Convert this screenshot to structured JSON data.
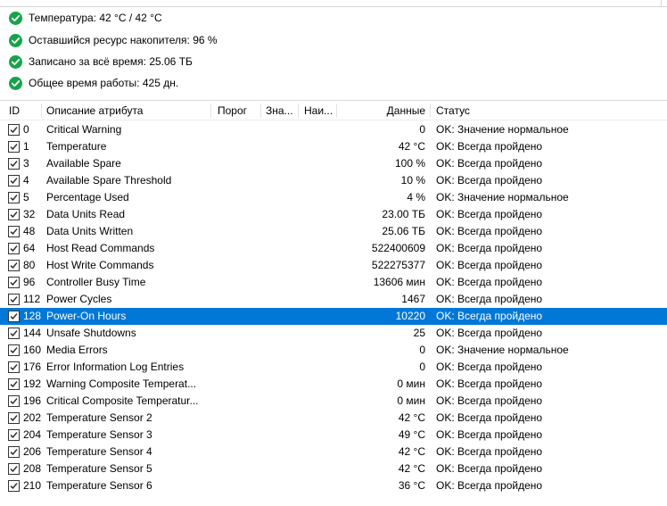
{
  "summary": [
    {
      "icon": "check-circle-icon",
      "text": "Температура: 42 °C / 42 °C"
    },
    {
      "icon": "check-circle-icon",
      "text": "Оставшийся ресурс накопителя: 96 %"
    },
    {
      "icon": "check-circle-icon",
      "text": "Записано за всё время: 25.06 ТБ"
    },
    {
      "icon": "check-circle-icon",
      "text": "Общее время работы: 425 дн."
    }
  ],
  "columns": {
    "id": "ID",
    "name": "Описание атрибута",
    "threshold": "Порог",
    "value": "Зна...",
    "worst": "Наи...",
    "data": "Данные",
    "status": "Статус"
  },
  "selected_id": "128",
  "rows": [
    {
      "id": "0",
      "name": "Critical Warning",
      "data": "0",
      "status": "OK: Значение нормальное",
      "checked": true
    },
    {
      "id": "1",
      "name": "Temperature",
      "data": "42 °C",
      "status": "OK: Всегда пройдено",
      "checked": true
    },
    {
      "id": "3",
      "name": "Available Spare",
      "data": "100 %",
      "status": "OK: Всегда пройдено",
      "checked": true
    },
    {
      "id": "4",
      "name": "Available Spare Threshold",
      "data": "10 %",
      "status": "OK: Всегда пройдено",
      "checked": true
    },
    {
      "id": "5",
      "name": "Percentage Used",
      "data": "4 %",
      "status": "OK: Значение нормальное",
      "checked": true
    },
    {
      "id": "32",
      "name": "Data Units Read",
      "data": "23.00 ТБ",
      "status": "OK: Всегда пройдено",
      "checked": true
    },
    {
      "id": "48",
      "name": "Data Units Written",
      "data": "25.06 ТБ",
      "status": "OK: Всегда пройдено",
      "checked": true
    },
    {
      "id": "64",
      "name": "Host Read Commands",
      "data": "522400609",
      "status": "OK: Всегда пройдено",
      "checked": true
    },
    {
      "id": "80",
      "name": "Host Write Commands",
      "data": "522275377",
      "status": "OK: Всегда пройдено",
      "checked": true
    },
    {
      "id": "96",
      "name": "Controller Busy Time",
      "data": "13606 мин",
      "status": "OK: Всегда пройдено",
      "checked": true
    },
    {
      "id": "112",
      "name": "Power Cycles",
      "data": "1467",
      "status": "OK: Всегда пройдено",
      "checked": true
    },
    {
      "id": "128",
      "name": "Power-On Hours",
      "data": "10220",
      "status": "OK: Всегда пройдено",
      "checked": true
    },
    {
      "id": "144",
      "name": "Unsafe Shutdowns",
      "data": "25",
      "status": "OK: Всегда пройдено",
      "checked": true
    },
    {
      "id": "160",
      "name": "Media Errors",
      "data": "0",
      "status": "OK: Значение нормальное",
      "checked": true
    },
    {
      "id": "176",
      "name": "Error Information Log Entries",
      "data": "0",
      "status": "OK: Всегда пройдено",
      "checked": true
    },
    {
      "id": "192",
      "name": "Warning Composite Temperat...",
      "data": "0 мин",
      "status": "OK: Всегда пройдено",
      "checked": true
    },
    {
      "id": "196",
      "name": "Critical Composite Temperatur...",
      "data": "0 мин",
      "status": "OK: Всегда пройдено",
      "checked": true
    },
    {
      "id": "202",
      "name": "Temperature Sensor 2",
      "data": "42 °C",
      "status": "OK: Всегда пройдено",
      "checked": true
    },
    {
      "id": "204",
      "name": "Temperature Sensor 3",
      "data": "49 °C",
      "status": "OK: Всегда пройдено",
      "checked": true
    },
    {
      "id": "206",
      "name": "Temperature Sensor 4",
      "data": "42 °C",
      "status": "OK: Всегда пройдено",
      "checked": true
    },
    {
      "id": "208",
      "name": "Temperature Sensor 5",
      "data": "42 °C",
      "status": "OK: Всегда пройдено",
      "checked": true
    },
    {
      "id": "210",
      "name": "Temperature Sensor 6",
      "data": "36 °C",
      "status": "OK: Всегда пройдено",
      "checked": true
    }
  ],
  "colors": {
    "ok_icon": "#17a34a",
    "selection": "#0078d7"
  }
}
